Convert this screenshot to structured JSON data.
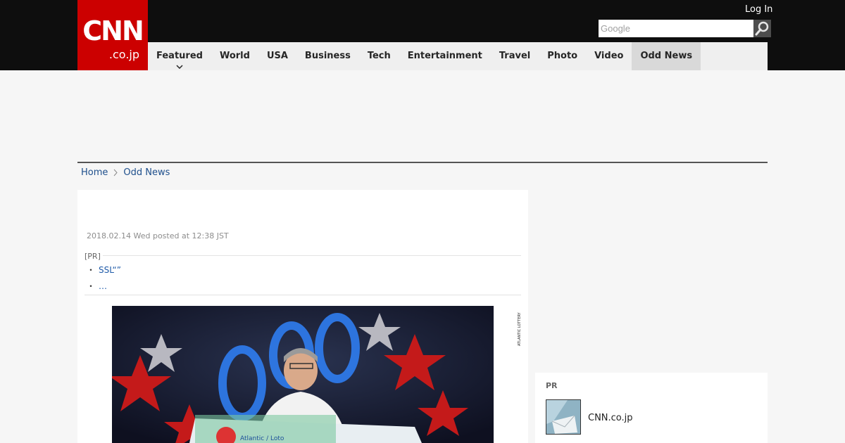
{
  "header": {
    "logo_main": "CNN",
    "logo_sub": ".co.jp",
    "login_label": "Log In",
    "search": {
      "placeholder": "Google",
      "value": ""
    }
  },
  "nav": {
    "items": [
      {
        "label": "Featured"
      },
      {
        "label": "World"
      },
      {
        "label": "USA"
      },
      {
        "label": "Business"
      },
      {
        "label": "Tech"
      },
      {
        "label": "Entertainment"
      },
      {
        "label": "Travel"
      },
      {
        "label": "Photo"
      },
      {
        "label": "Video"
      },
      {
        "label": "Odd News"
      }
    ],
    "active": "Odd News"
  },
  "breadcrumb": {
    "home": "Home",
    "current": "Odd News"
  },
  "article": {
    "posted": "2018.02.14 Wed posted at 12:38 JST",
    "pr_label": "[PR]",
    "pr_links": [
      {
        "text": "SSL“”"
      },
      {
        "text": "…"
      }
    ],
    "photo_credit": "ATLANTIC LOTTERY",
    "photo_sign_text": "Atlantic / Loto"
  },
  "sidebar": {
    "pr_title": "PR",
    "pr_item": "CNN.co.jp"
  },
  "colors": {
    "brand_red": "#cc0000",
    "topbar_black": "#0e0e0e",
    "link_blue": "#1e4f8c"
  }
}
